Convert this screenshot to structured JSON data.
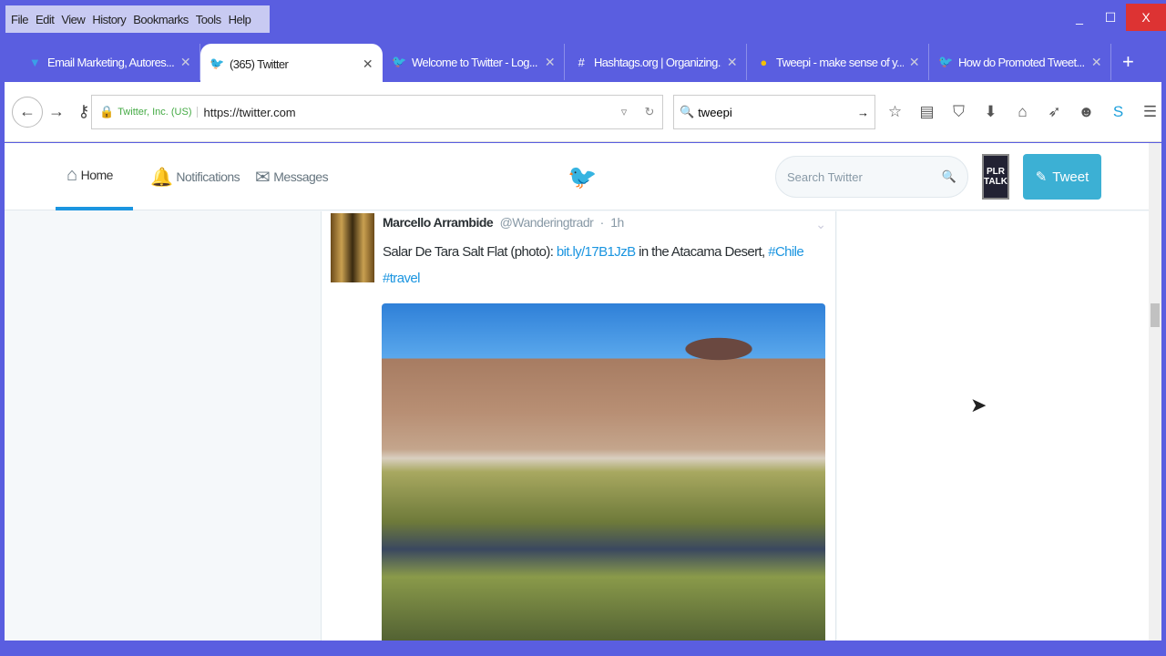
{
  "menu": [
    "File",
    "Edit",
    "View",
    "History",
    "Bookmarks",
    "Tools",
    "Help"
  ],
  "window_controls": {
    "minimize": "_",
    "maximize": "☐",
    "close": "X"
  },
  "tabs": [
    {
      "title": "Email Marketing, Autores...",
      "icon": "aweber-icon"
    },
    {
      "title": "(365) Twitter",
      "icon": "twitter-icon",
      "active": true
    },
    {
      "title": "Welcome to Twitter - Log...",
      "icon": "twitter-icon"
    },
    {
      "title": "Hashtags.org | Organizing...",
      "icon": "hashtag-icon"
    },
    {
      "title": "Tweepi - make sense of y...",
      "icon": "tweepi-icon"
    },
    {
      "title": "How do Promoted Tweet...",
      "icon": "twitter-icon"
    }
  ],
  "navbar": {
    "identity": "Twitter, Inc. (US)",
    "url": "https://twitter.com",
    "search_value": "tweepi"
  },
  "twitter": {
    "nav": {
      "home": "Home",
      "notifications": "Notifications",
      "messages": "Messages"
    },
    "search_placeholder": "Search Twitter",
    "plr": "PLR TALK",
    "tweet_button": "Tweet",
    "tweet": {
      "name": "Marcello Arrambide",
      "handle": "@Wanderingtradr",
      "time": "1h",
      "text_before": "Salar De Tara Salt Flat (photo): ",
      "link": "bit.ly/17B1JzB",
      "text_mid": " in the Atacama Desert, ",
      "hashtag1": "#Chile",
      "hashtag2": "#travel"
    }
  }
}
